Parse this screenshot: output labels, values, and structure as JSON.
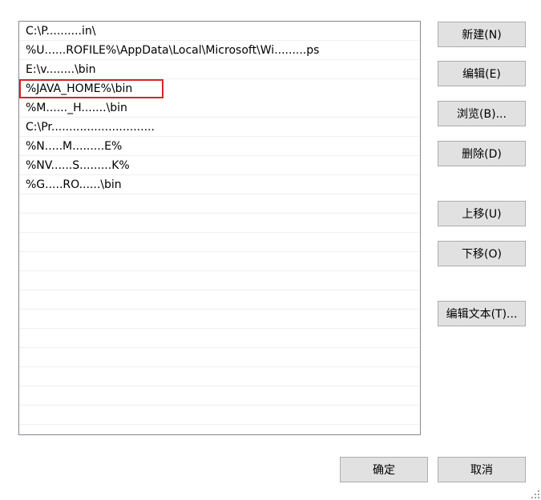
{
  "path_entries": [
    "C:\\P..........in\\",
    "%U......ROFILE%\\AppData\\Local\\Microsoft\\Wi.........ps",
    "E:\\v........\\bin",
    "%JAVA_HOME%\\bin",
    "%M......_H.......\\bin",
    "C:\\Pr.............................",
    "%N.....M.........E%",
    "%NV......S.........K%",
    "%G.....RO......\\bin",
    "",
    "",
    "",
    "",
    "",
    "",
    "",
    "",
    "",
    "",
    "",
    ""
  ],
  "highlighted_entry_index": 3,
  "buttons": {
    "new": "新建(N)",
    "edit": "编辑(E)",
    "browse": "浏览(B)...",
    "delete": "删除(D)",
    "move_up": "上移(U)",
    "move_down": "下移(O)",
    "edit_text": "编辑文本(T)...",
    "ok": "确定",
    "cancel": "取消"
  },
  "colors": {
    "highlight_border": "#d9232a",
    "button_bg": "#e1e1e1",
    "button_border": "#adadad",
    "list_border": "#828790"
  }
}
